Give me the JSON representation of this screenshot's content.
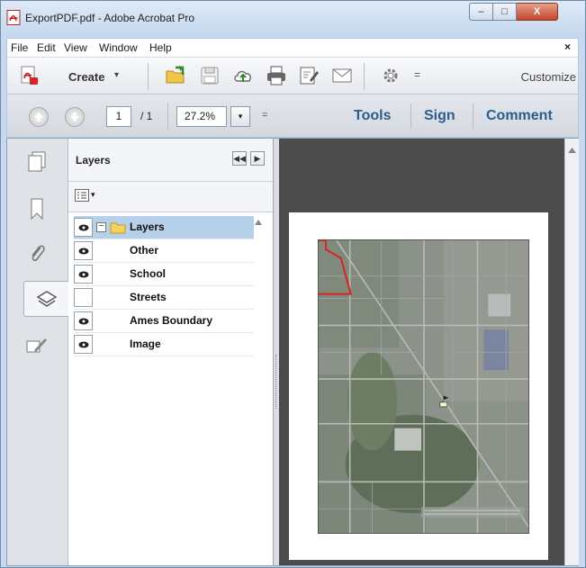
{
  "window": {
    "title": "ExportPDF.pdf - Adobe Acrobat Pro",
    "minimize": "–",
    "maximize": "□",
    "close": "X"
  },
  "menu": {
    "items": [
      "File",
      "Edit",
      "View",
      "Window",
      "Help"
    ],
    "close": "×"
  },
  "toolbar": {
    "create_label": "Create",
    "create_caret": "▾",
    "overflow": "=",
    "customize": "Customize"
  },
  "navigation": {
    "page_value": "1",
    "page_total": "/ 1",
    "zoom_value": "27.2%",
    "zoom_caret": "▾",
    "overflow": "=",
    "tools": "Tools",
    "sign": "Sign",
    "comment": "Comment"
  },
  "layers_panel": {
    "title": "Layers",
    "collapse_btn": "◀◀",
    "expand_btn": "▶",
    "options_caret": "▾",
    "root": {
      "label": "Layers",
      "expander": "−",
      "visible": true
    },
    "items": [
      {
        "label": "Other",
        "visible": true
      },
      {
        "label": "School",
        "visible": true
      },
      {
        "label": "Streets",
        "visible": false
      },
      {
        "label": "Ames Boundary",
        "visible": true
      },
      {
        "label": "Image",
        "visible": true
      }
    ]
  },
  "colors": {
    "accent_blue": "#2c5d8c",
    "selection": "#b6d0ea",
    "doc_background": "#4c4c4c",
    "boundary_red": "#e02020"
  }
}
